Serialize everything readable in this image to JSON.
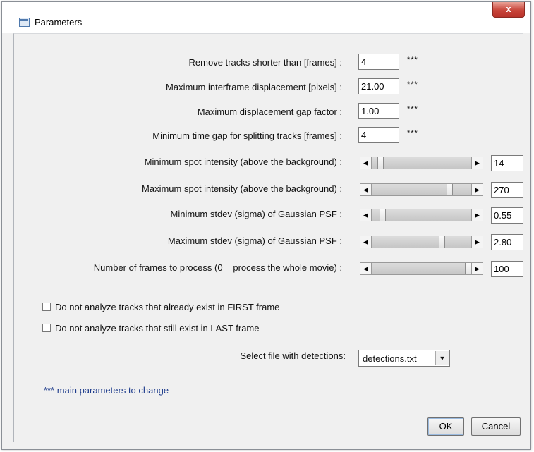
{
  "window": {
    "title": "Parameters",
    "close_label": "x"
  },
  "text_params": [
    {
      "label": "Remove tracks shorter than [frames] :",
      "value": "4",
      "marker": "***"
    },
    {
      "label": "Maximum interframe displacement [pixels] :",
      "value": "21.00",
      "marker": "***"
    },
    {
      "label": "Maximum displacement gap factor :",
      "value": "1.00",
      "marker": "***"
    },
    {
      "label": "Minimum time gap for splitting tracks [frames] :",
      "value": "4",
      "marker": "***"
    }
  ],
  "slider_params": [
    {
      "label": "Minimum spot intensity (above the background) :",
      "value": "14",
      "position": 0.06
    },
    {
      "label": "Maximum spot intensity (above the background) :",
      "value": "270",
      "position": 0.8
    },
    {
      "label": "Minimum stdev (sigma) of Gaussian PSF :",
      "value": "0.55",
      "position": 0.08
    },
    {
      "label": "Maximum stdev (sigma) of Gaussian PSF :",
      "value": "2.80",
      "position": 0.72
    },
    {
      "label": "Number of frames to process (0 = process the whole movie) :",
      "value": "100",
      "position": 1.0
    }
  ],
  "checkboxes": [
    {
      "label": "Do not analyze tracks that already exist in FIRST frame",
      "checked": false
    },
    {
      "label": "Do not analyze tracks that still exist in LAST frame",
      "checked": false
    }
  ],
  "detections": {
    "label": "Select file with detections:",
    "selected": "detections.txt"
  },
  "note": "*** main parameters to change",
  "buttons": {
    "ok": "OK",
    "cancel": "Cancel"
  },
  "icons": {
    "left_arrow": "◀",
    "right_arrow": "▶",
    "dropdown": "▼"
  }
}
